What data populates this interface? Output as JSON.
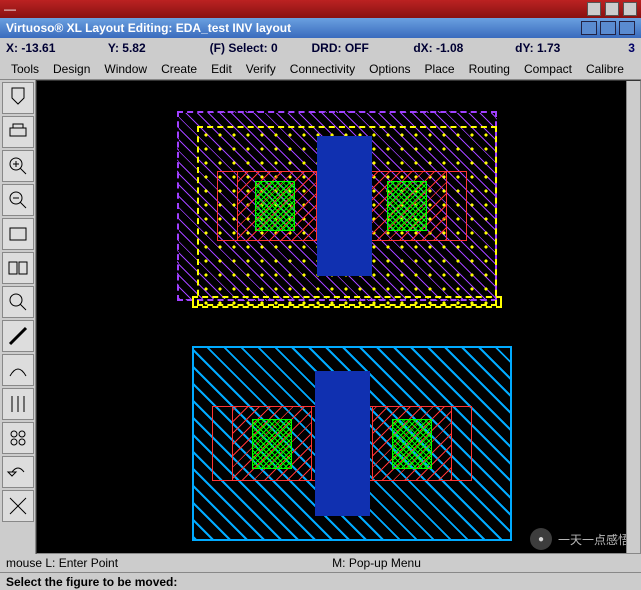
{
  "window": {
    "title": "Virtuoso® XL Layout Editing: EDA_test INV layout"
  },
  "status": {
    "x_label": "X:",
    "x_val": "-13.61",
    "y_label": "Y:",
    "y_val": "5.82",
    "sel_label": "(F) Select:",
    "sel_val": "0",
    "drd_label": "DRD:",
    "drd_val": "OFF",
    "dx_label": "dX:",
    "dx_val": "-1.08",
    "dy_label": "dY:",
    "dy_val": "1.73",
    "num": "3"
  },
  "menu": {
    "tools": "Tools",
    "design": "Design",
    "window": "Window",
    "create": "Create",
    "edit": "Edit",
    "verify": "Verify",
    "connectivity": "Connectivity",
    "options": "Options",
    "place": "Place",
    "routing": "Routing",
    "compact": "Compact",
    "calibre": "Calibre"
  },
  "mouse": {
    "left": "mouse L: Enter Point",
    "mid": "M: Pop-up Menu"
  },
  "prompt": "Select the figure to be moved:",
  "watermark": "一天一点感悟",
  "chart_data": {
    "type": "layout",
    "cells": [
      {
        "name": "pmos-region",
        "outline": "purple-dashed",
        "well": "yellow-dotted-nwell",
        "diffusion": {
          "layer": "red",
          "contacts": [
            "left",
            "right"
          ]
        },
        "poly": "blue-vertical",
        "active_contacts": [
          "green-left",
          "green-right"
        ]
      },
      {
        "name": "nmos-region",
        "outline": "cyan-solid",
        "diffusion": {
          "layer": "red",
          "contacts": [
            "left",
            "right"
          ]
        },
        "poly": "blue-vertical",
        "active_contacts": [
          "green-left",
          "green-right"
        ],
        "metal": "cyan-diag-hatch"
      }
    ]
  }
}
